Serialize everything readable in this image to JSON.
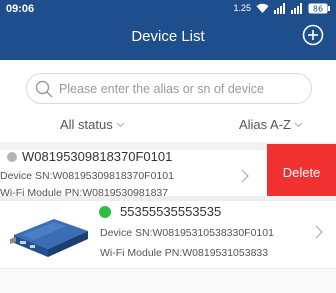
{
  "status_bar": {
    "time": "09:06",
    "data_rate": "1.25",
    "battery": "86"
  },
  "nav": {
    "title": "Device List",
    "add_icon": "plus-circle-icon"
  },
  "search": {
    "placeholder": "Please enter the alias or sn of device",
    "value": ""
  },
  "filters": {
    "status_label": "All status",
    "sort_label": "Alias A-Z"
  },
  "devices": [
    {
      "alias": "W08195309818370F0101",
      "sn": "Device SN:W08195309818370F0101",
      "pn": "Wi-Fi Module PN:W0819530981837",
      "status_color": "#b3b3b3",
      "swiped": true,
      "delete_label": "Delete"
    },
    {
      "alias": "55355535553535",
      "sn": "Device SN:W08195310538330F0101",
      "pn": "Wi-Fi Module PN:W0819531053833",
      "status_color": "#2fbf43",
      "swiped": false
    }
  ],
  "colors": {
    "header": "#1f4e8c",
    "delete": "#f1312f",
    "online": "#2fbf43",
    "offline": "#b3b3b3"
  }
}
